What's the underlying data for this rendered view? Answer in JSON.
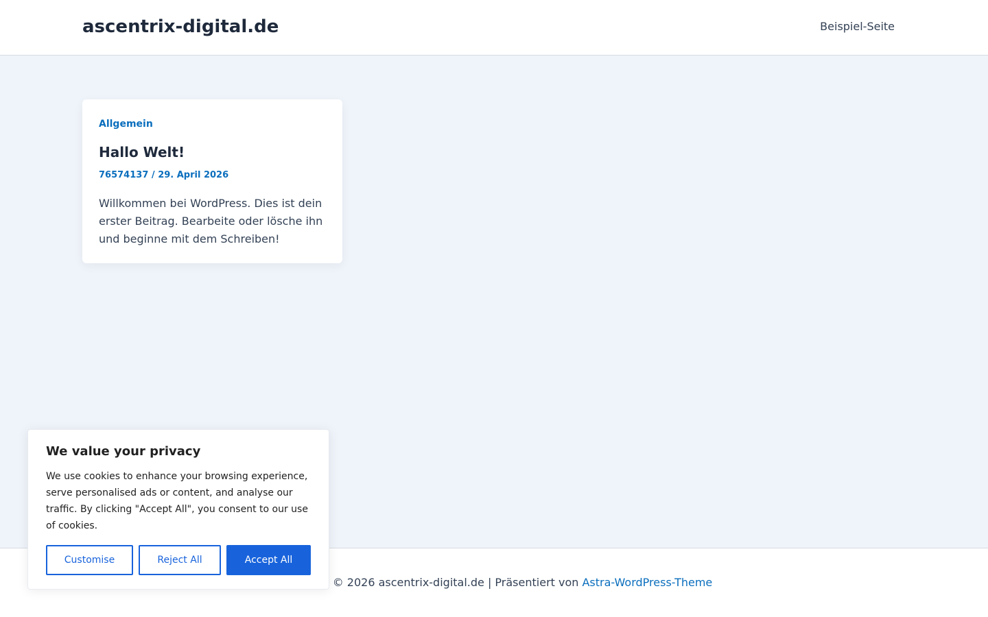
{
  "header": {
    "site_title": "ascentrix-digital.de",
    "nav": [
      {
        "label": "Beispiel-Seite"
      }
    ]
  },
  "post": {
    "category": "Allgemein",
    "title": "Hallo Welt!",
    "author": "76574137",
    "separator": " / ",
    "date": "29. April 2026",
    "excerpt": "Willkommen bei WordPress. Dies ist dein erster Beitrag. Bearbeite oder lösche ihn und beginne mit dem Schreiben!"
  },
  "footer": {
    "copyright": "© 2026 ascentrix-digital.de | Präsentiert von ",
    "theme_link": "Astra-WordPress-Theme"
  },
  "cookie_banner": {
    "title": "We value your privacy",
    "text": "We use cookies to enhance your browsing experience, serve personalised ads or content, and analyse our traffic. By clicking \"Accept All\", you consent to our use of cookies.",
    "customise_label": "Customise",
    "reject_label": "Reject All",
    "accept_label": "Accept All"
  },
  "colors": {
    "accent": "#0a6ebd",
    "cookie_button": "#1863dc",
    "page_background": "#eff4fa"
  }
}
